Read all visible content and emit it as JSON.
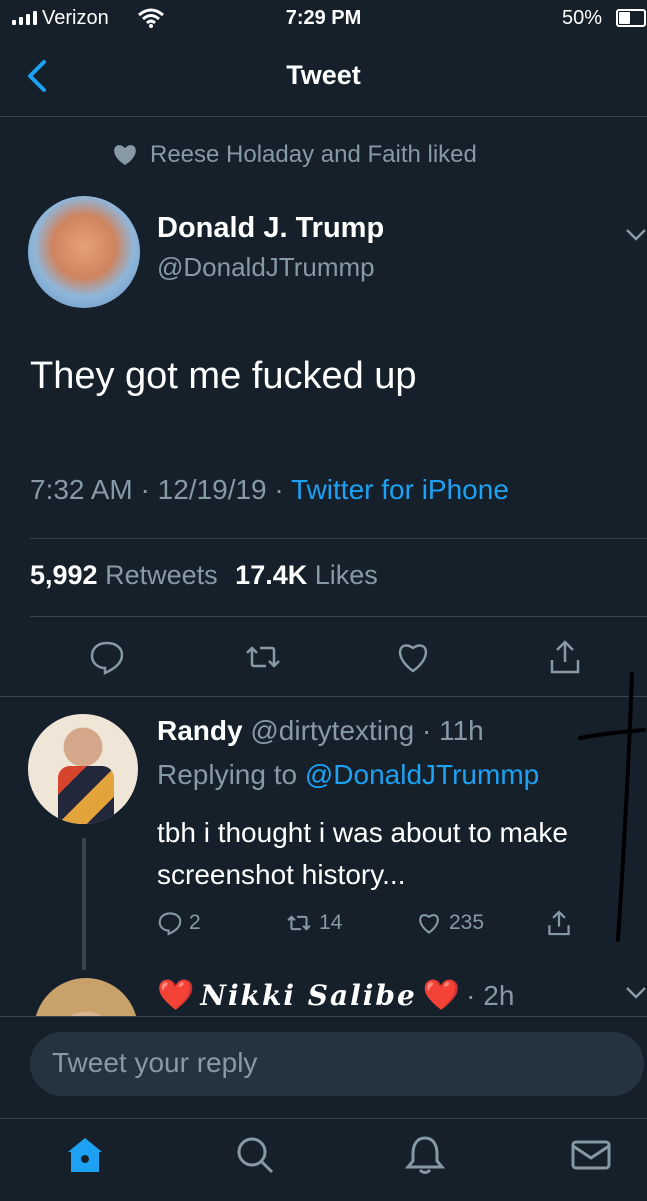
{
  "status_bar": {
    "carrier": "Verizon",
    "time": "7:29 PM",
    "battery": "50%",
    "battery_level": 0.5
  },
  "nav": {
    "title": "Tweet",
    "back_icon": "chevron-left-icon"
  },
  "social_context": {
    "icon": "heart-icon",
    "text": "Reese Holaday and Faith liked"
  },
  "tweet": {
    "author_name": "Donald J. Trump",
    "author_handle": "@DonaldJTrummp",
    "text": "They got me fucked up",
    "time": "7:32 AM",
    "date": "12/19/19",
    "separator": "·",
    "source": "Twitter for iPhone",
    "retweets_count": "5,992",
    "retweets_label": "Retweets",
    "likes_count": "17.4K",
    "likes_label": "Likes"
  },
  "reply": {
    "name": "Randy",
    "handle": "@dirtytexting",
    "age": "· 11h",
    "replying_label": "Replying to",
    "replying_to": "@DonaldJTrummp",
    "text": "tbh i thought i was about to make screenshot history...",
    "reply_count": "2",
    "retweet_count": "14",
    "like_count": "235"
  },
  "next_reply": {
    "name_left_emoji": "❤️",
    "name": "Nikki Salibe",
    "name_right_emoji": "❤️",
    "age": "· 2h"
  },
  "compose": {
    "placeholder": "Tweet your reply"
  },
  "tabs": [
    "home-icon",
    "search-icon",
    "notifications-icon",
    "messages-icon"
  ],
  "colors": {
    "background": "#15202b",
    "accent": "#1da1f2",
    "muted": "#8899a6",
    "divider": "#38444d"
  }
}
